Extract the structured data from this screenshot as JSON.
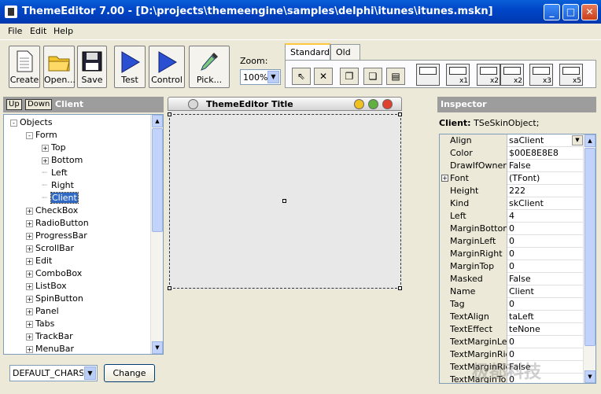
{
  "window": {
    "title": "ThemeEditor 7.00 - [D:\\projects\\themeengine\\samples\\delphi\\itunes\\itunes.mskn]",
    "min": "_",
    "max": "□",
    "close": "✕"
  },
  "menu": [
    "File",
    "Edit",
    "Help"
  ],
  "toolbar": {
    "buttons": [
      "Create",
      "Open...",
      "Save",
      "Test",
      "Control",
      "Pick..."
    ],
    "zoom_label": "Zoom:",
    "zoom_value": "100%",
    "tabs": [
      "Standard",
      "Old"
    ],
    "standard_items": [
      "x1",
      "x2",
      "x2",
      "x3",
      "x5"
    ]
  },
  "left_panel": {
    "up": "Up",
    "down": "Down",
    "title": "Client",
    "tree": [
      {
        "label": "Objects",
        "level": 0,
        "exp": "-"
      },
      {
        "label": "Form",
        "level": 1,
        "exp": "-"
      },
      {
        "label": "Top",
        "level": 2,
        "exp": "+"
      },
      {
        "label": "Bottom",
        "level": 2,
        "exp": "+"
      },
      {
        "label": "Left",
        "level": 2,
        "exp": ""
      },
      {
        "label": "Right",
        "level": 2,
        "exp": ""
      },
      {
        "label": "Client",
        "level": 2,
        "exp": "",
        "selected": true
      },
      {
        "label": "CheckBox",
        "level": 1,
        "exp": "+"
      },
      {
        "label": "RadioButton",
        "level": 1,
        "exp": "+"
      },
      {
        "label": "ProgressBar",
        "level": 1,
        "exp": "+"
      },
      {
        "label": "ScrollBar",
        "level": 1,
        "exp": "+"
      },
      {
        "label": "Edit",
        "level": 1,
        "exp": "+"
      },
      {
        "label": "ComboBox",
        "level": 1,
        "exp": "+"
      },
      {
        "label": "ListBox",
        "level": 1,
        "exp": "+"
      },
      {
        "label": "SpinButton",
        "level": 1,
        "exp": "+"
      },
      {
        "label": "Panel",
        "level": 1,
        "exp": "+"
      },
      {
        "label": "Tabs",
        "level": 1,
        "exp": "+"
      },
      {
        "label": "TrackBar",
        "level": 1,
        "exp": "+"
      },
      {
        "label": "MenuBar",
        "level": 1,
        "exp": "+"
      }
    ],
    "charset": "DEFAULT_CHARSET",
    "change": "Change"
  },
  "design": {
    "skin_title": "ThemeEditor Title"
  },
  "inspector": {
    "title": "Inspector",
    "object_label": "Client:",
    "object_type": "TSeSkinObject;",
    "props": [
      {
        "k": "Align",
        "v": "saClient",
        "dd": true
      },
      {
        "k": "Color",
        "v": "$00E8E8E8"
      },
      {
        "k": "DrawIfOwner",
        "v": "False"
      },
      {
        "k": "Font",
        "v": "(TFont)",
        "exp": "+"
      },
      {
        "k": "Height",
        "v": "222"
      },
      {
        "k": "Kind",
        "v": "skClient"
      },
      {
        "k": "Left",
        "v": "4"
      },
      {
        "k": "MarginBottom",
        "v": "0"
      },
      {
        "k": "MarginLeft",
        "v": "0"
      },
      {
        "k": "MarginRight",
        "v": "0"
      },
      {
        "k": "MarginTop",
        "v": "0"
      },
      {
        "k": "Masked",
        "v": "False"
      },
      {
        "k": "Name",
        "v": "Client"
      },
      {
        "k": "Tag",
        "v": "0"
      },
      {
        "k": "TextAlign",
        "v": "taLeft"
      },
      {
        "k": "TextEffect",
        "v": "teNone"
      },
      {
        "k": "TextMarginLeft",
        "v": "0"
      },
      {
        "k": "TextMarginRight",
        "v": "0"
      },
      {
        "k": "TextMarginRightFalse",
        "v": "False"
      },
      {
        "k": "TextMarginTop",
        "v": "0"
      }
    ]
  },
  "watermark": "极都科技"
}
